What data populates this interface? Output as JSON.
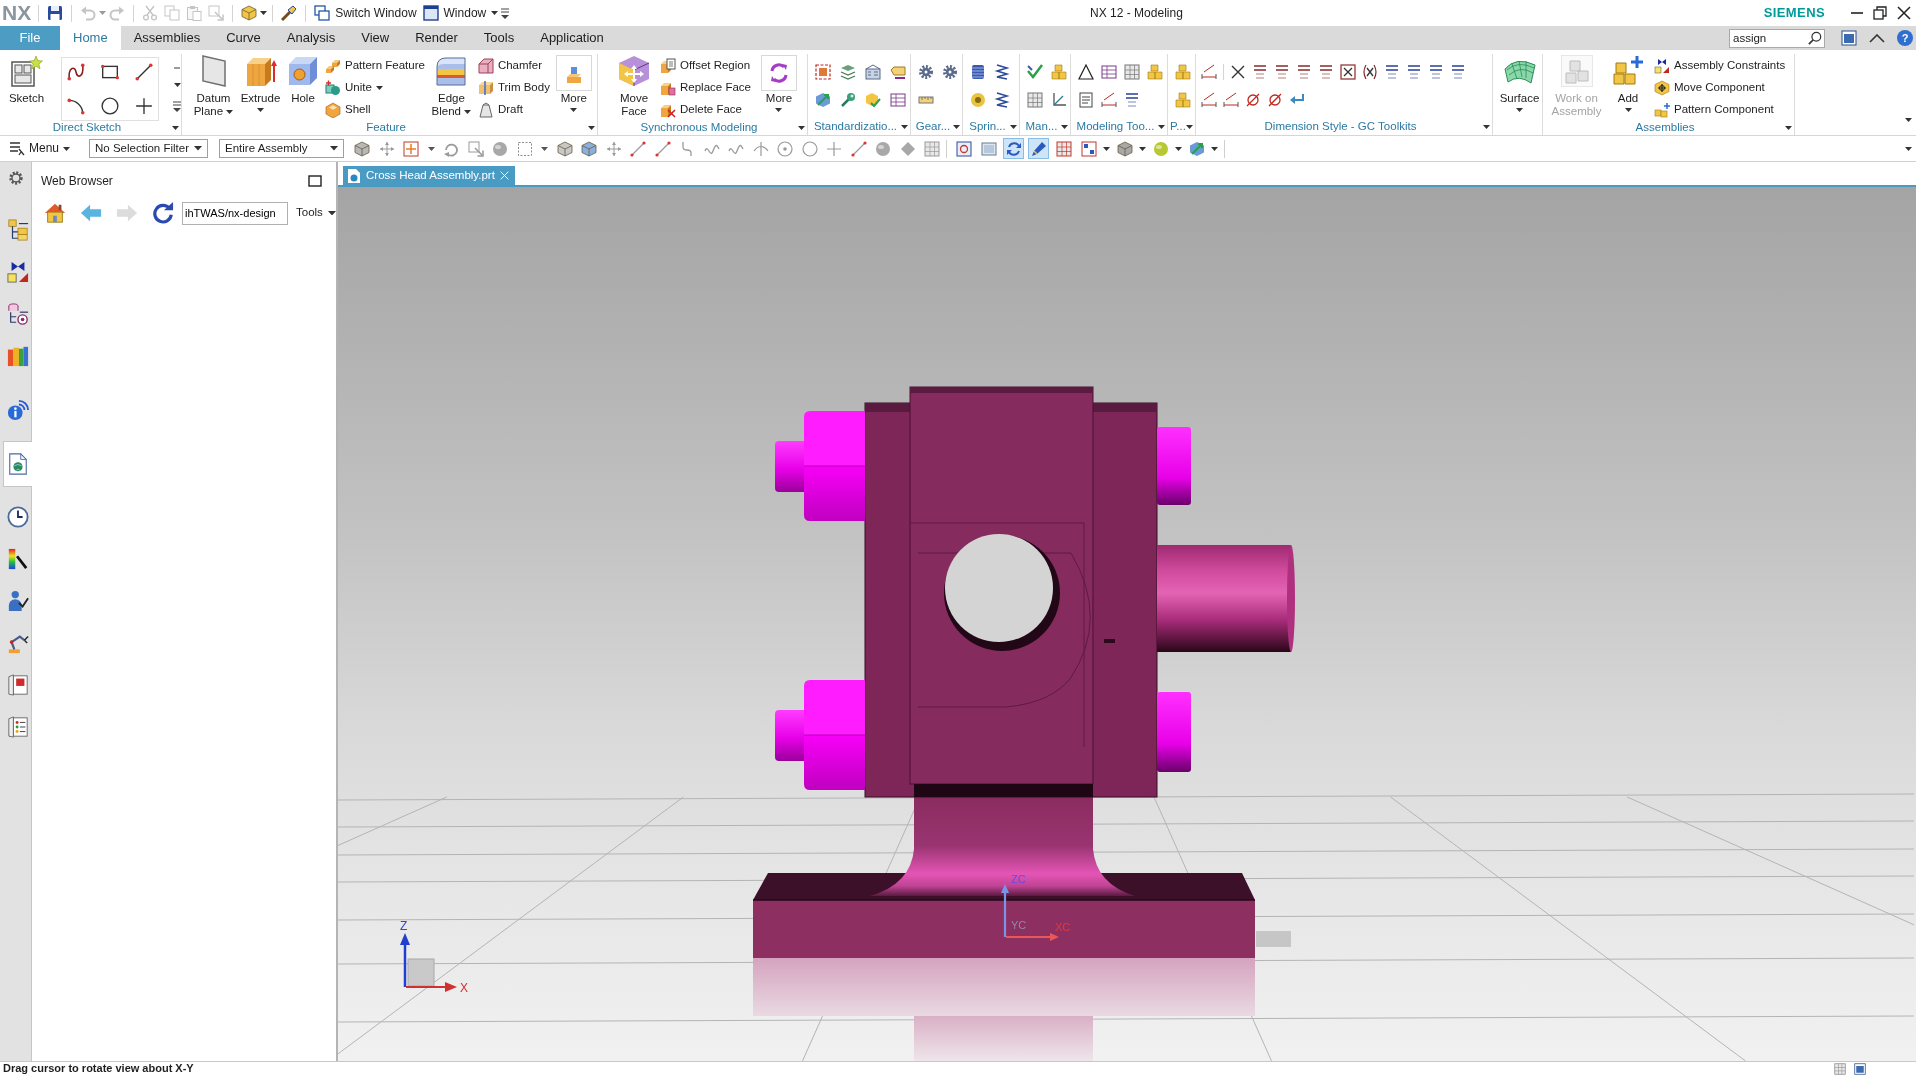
{
  "title_bar": {
    "logo": "NX",
    "quick_access": [
      {
        "disabled": false
      },
      {
        "disabled": true
      },
      {
        "disabled": true
      },
      {
        "disabled": true
      },
      {
        "disabled": true
      },
      {
        "disabled": true
      },
      {
        "disabled": true
      },
      {
        "disabled": false
      },
      {
        "disabled": false
      }
    ],
    "switch_window": "Switch Window",
    "window_menu": "Window",
    "title": "NX 12 - Modeling",
    "brand": "SIEMENS"
  },
  "menu_tabs": [
    {
      "label": "File",
      "kind": "file",
      "selected": false
    },
    {
      "label": "Home",
      "kind": "tab",
      "selected": true
    },
    {
      "label": "Assemblies",
      "kind": "tab",
      "selected": false
    },
    {
      "label": "Curve",
      "kind": "tab",
      "selected": false
    },
    {
      "label": "Analysis",
      "kind": "tab",
      "selected": false
    },
    {
      "label": "View",
      "kind": "tab",
      "selected": false
    },
    {
      "label": "Render",
      "kind": "tab",
      "selected": false
    },
    {
      "label": "Tools",
      "kind": "tab",
      "selected": false
    },
    {
      "label": "Application",
      "kind": "tab",
      "selected": false
    }
  ],
  "command_search": {
    "value": "assign"
  },
  "help_button": "?",
  "ribbon_groups": [
    {
      "title": "Direct Sketch",
      "items": [
        {
          "kind": "large",
          "label": "Sketch",
          "dropdown": false
        }
      ]
    },
    {
      "title": "Feature",
      "items": [
        {
          "kind": "large",
          "label": "Datum Plane",
          "dropdown": true
        },
        {
          "kind": "large",
          "label": "Extrude",
          "dropdown": true
        },
        {
          "kind": "large",
          "label": "Hole",
          "dropdown": false
        },
        {
          "kind": "small",
          "label": "Pattern Feature",
          "dropdown": false
        },
        {
          "kind": "small",
          "label": "Unite",
          "dropdown": true
        },
        {
          "kind": "small",
          "label": "Shell",
          "dropdown": false
        },
        {
          "kind": "large",
          "label": "Edge Blend",
          "dropdown": true
        },
        {
          "kind": "small",
          "label": "Chamfer",
          "dropdown": false
        },
        {
          "kind": "small",
          "label": "Trim Body",
          "dropdown": false
        },
        {
          "kind": "small",
          "label": "Draft",
          "dropdown": false
        },
        {
          "kind": "gallery",
          "label": "More",
          "dropdown": true
        }
      ]
    },
    {
      "title": "Synchronous Modeling",
      "items": [
        {
          "kind": "large",
          "label": "Move Face",
          "dropdown": false
        },
        {
          "kind": "small",
          "label": "Offset Region",
          "dropdown": false
        },
        {
          "kind": "small",
          "label": "Replace Face",
          "dropdown": false
        },
        {
          "kind": "small",
          "label": "Delete Face",
          "dropdown": false
        },
        {
          "kind": "gallery",
          "label": "More",
          "dropdown": true
        }
      ]
    },
    {
      "title": "Standardizatio..."
    },
    {
      "title": "Gear..."
    },
    {
      "title": "Sprin..."
    },
    {
      "title": "Man..."
    },
    {
      "title": "Modeling Too..."
    },
    {
      "title": "P..."
    },
    {
      "title": "Dimension Style - GC Toolkits"
    },
    {
      "items": [
        {
          "kind": "large",
          "label": "Surface",
          "dropdown": true
        }
      ]
    },
    {
      "title": "Assemblies",
      "items": [
        {
          "kind": "large",
          "label": "Work on Assembly",
          "dropdown": false,
          "disabled": true
        },
        {
          "kind": "large",
          "label": "Add",
          "dropdown": true,
          "disabled": false
        },
        {
          "kind": "small",
          "label": "Assembly Constraints",
          "dropdown": false,
          "disabled": false
        },
        {
          "kind": "small",
          "label": "Move Component",
          "dropdown": false,
          "disabled": false
        },
        {
          "kind": "small",
          "label": "Pattern Component",
          "dropdown": false,
          "disabled": false
        }
      ]
    }
  ],
  "selection_bar": {
    "menu": "Menu",
    "filters": [
      {
        "value": "No Selection Filter"
      },
      {
        "value": "Entire Assembly"
      }
    ],
    "view_tools": [
      {
        "selected": false
      },
      {
        "selected": false
      },
      {
        "selected": true
      },
      {
        "selected": true
      },
      {
        "selected": false
      },
      {
        "selected": false
      },
      {
        "selected": false
      },
      {
        "selected": false
      },
      {
        "selected": false
      }
    ]
  },
  "resource_bar": [
    {
      "selected": false
    },
    {
      "selected": false
    },
    {
      "selected": false
    },
    {
      "selected": false
    },
    {
      "selected": false
    },
    {
      "selected": true
    },
    {
      "selected": false
    },
    {
      "selected": false
    },
    {
      "selected": false
    },
    {
      "selected": false
    },
    {
      "selected": false
    },
    {
      "selected": false
    }
  ],
  "web_browser": {
    "title": "Web Browser",
    "nav_buttons": [
      {
        "disabled": false
      },
      {
        "disabled": false
      },
      {
        "disabled": true
      },
      {
        "disabled": false
      }
    ],
    "address": {
      "value": "ihTWAS/nx-design"
    },
    "tools_menu": "Tools"
  },
  "document_tabs": [
    {
      "label": "Cross Head Assembly.prt",
      "selected": true
    }
  ],
  "graphics": {
    "wcs_labels": [
      "ZC",
      "YC",
      "XC"
    ],
    "triad_labels": [
      "Z",
      "X"
    ]
  },
  "status_bar": {
    "message": "Drag cursor to rotate view about X-Y"
  }
}
